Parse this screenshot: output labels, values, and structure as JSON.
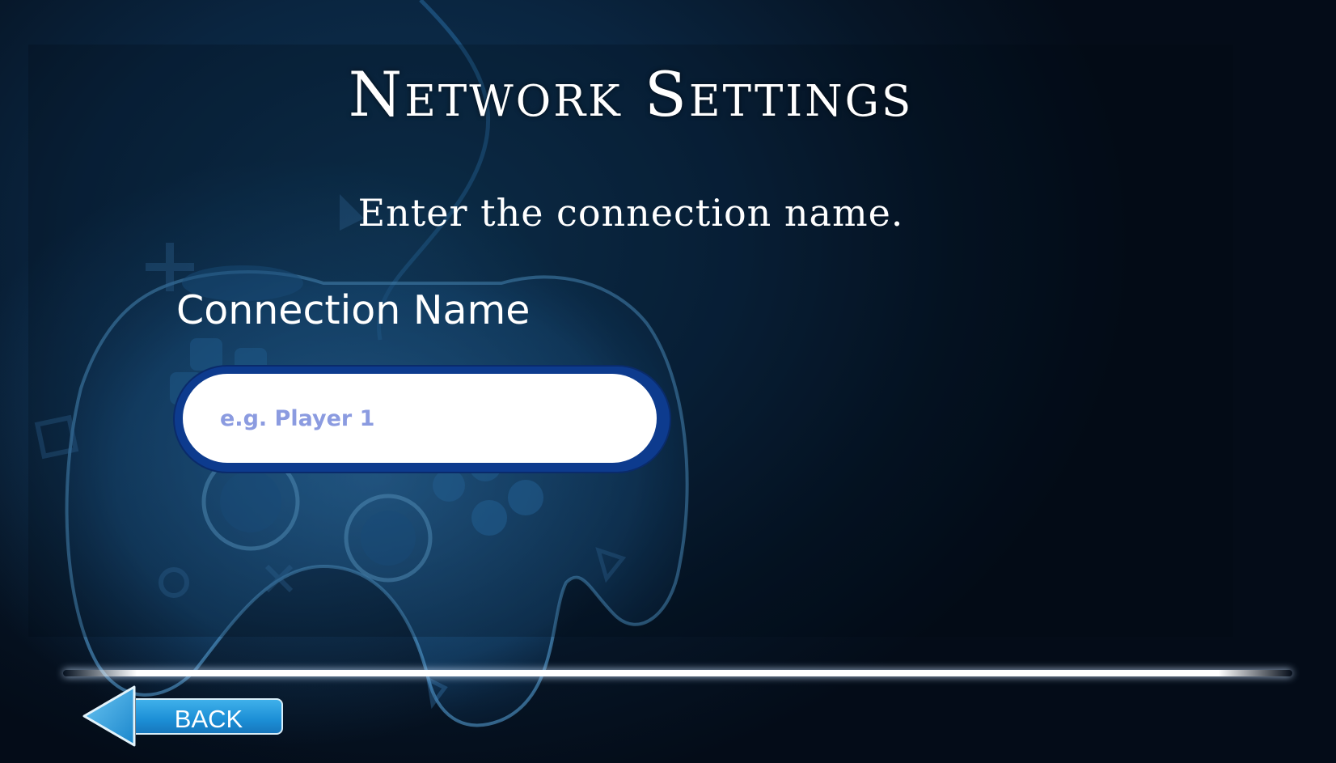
{
  "screen": {
    "title": "Network Settings",
    "subtitle": "Enter the connection name."
  },
  "form": {
    "label": "Connection Name",
    "input": {
      "value": "",
      "placeholder": "e.g. Player 1"
    }
  },
  "footer": {
    "back_label": "BACK"
  },
  "colors": {
    "background": "#0a2540",
    "input_border": "#0d3b8e",
    "placeholder": "#8b9be0",
    "back_button": "#1c8fd6",
    "text": "#ffffff"
  },
  "icons": {
    "background_art": "game-controller-icon",
    "back": "back-arrow-icon"
  }
}
